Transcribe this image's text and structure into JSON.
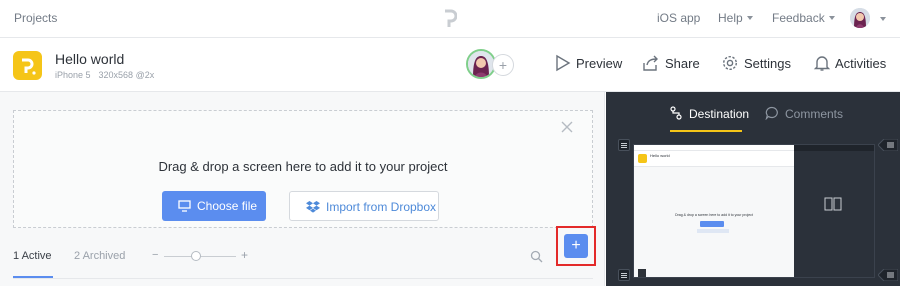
{
  "topbar": {
    "projects_link": "Projects",
    "ios_app": "iOS app",
    "help": "Help",
    "feedback": "Feedback"
  },
  "project": {
    "name": "Hello world",
    "device": "iPhone 5",
    "resolution": "320x568 @2x",
    "add_collaborator": "+"
  },
  "actions": {
    "preview": "Preview",
    "share": "Share",
    "settings": "Settings",
    "activities": "Activities"
  },
  "dropzone": {
    "title": "Drag & drop a screen here to add it to your project",
    "choose_file": "Choose file",
    "import_dropbox": "Import from Dropbox"
  },
  "screen_tabs": {
    "active": "1 Active",
    "archived": "2 Archived",
    "zoom_minus": "−",
    "zoom_plus": "+",
    "zoom_level": 0.45,
    "add_button": "+"
  },
  "right_panel": {
    "tab_destination": "Destination",
    "tab_comments": "Comments"
  },
  "colors": {
    "accent": "#5b8def",
    "brand_yellow": "#f5c518",
    "highlight": "#e32a2a",
    "panel_dark": "#2b313a"
  }
}
